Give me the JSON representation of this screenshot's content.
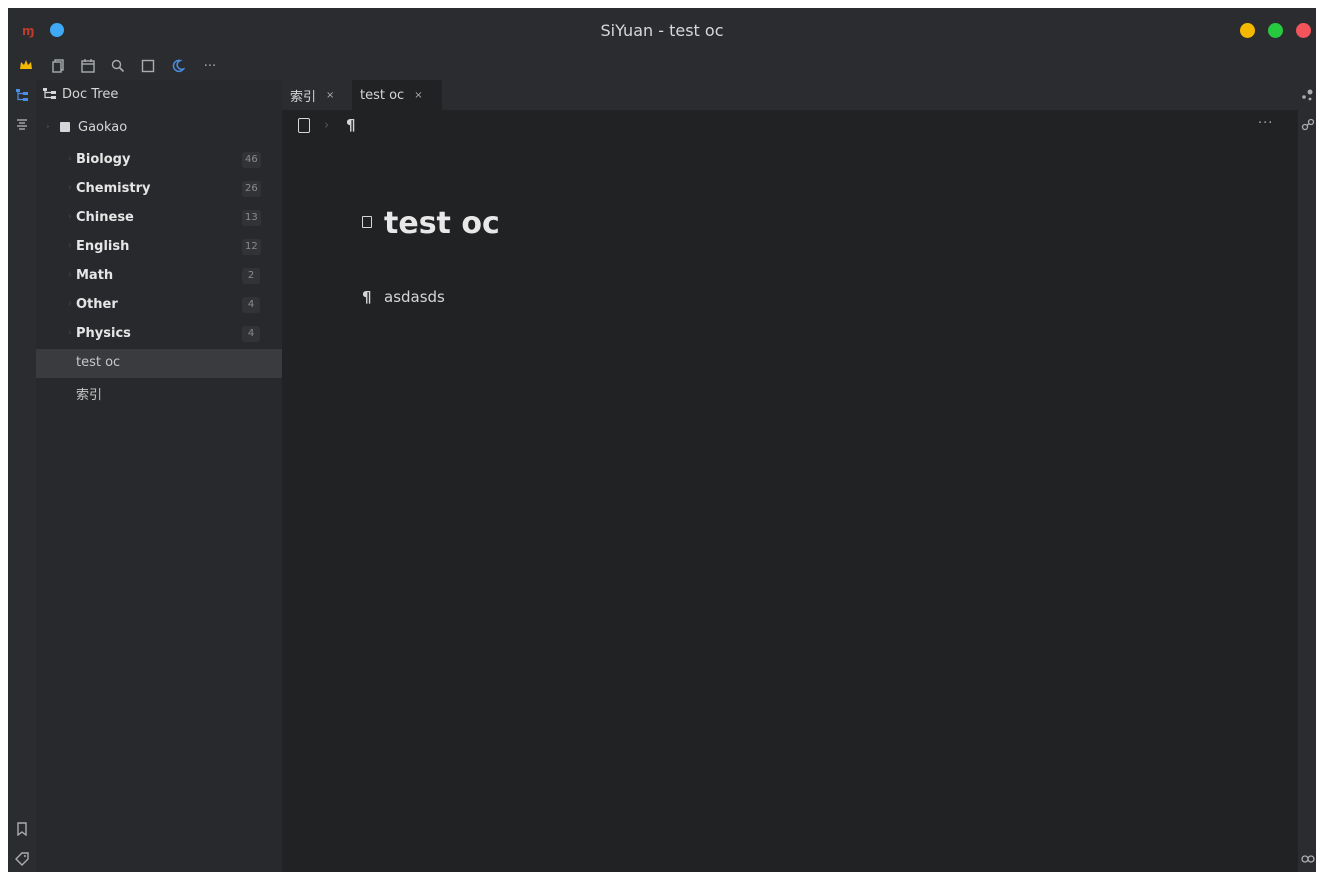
{
  "window": {
    "title": "SiYuan - test oc"
  },
  "toolbar": {
    "icons": [
      "crown-icon",
      "copy-icon",
      "calendar-icon",
      "search-icon",
      "square-icon",
      "moon-icon",
      "more-icon"
    ]
  },
  "tree": {
    "header_label": "Doc Tree",
    "notebook": "Gaokao",
    "docs": [
      {
        "label": "Biology",
        "count": "46",
        "bold": true
      },
      {
        "label": "Chemistry",
        "count": "26",
        "bold": true
      },
      {
        "label": "Chinese",
        "count": "13",
        "bold": true
      },
      {
        "label": "English",
        "count": "12",
        "bold": true
      },
      {
        "label": "Math",
        "count": "2",
        "bold": true
      },
      {
        "label": "Other",
        "count": "4",
        "bold": true
      },
      {
        "label": "Physics",
        "count": "4",
        "bold": true
      },
      {
        "label": "test oc",
        "count": "",
        "bold": false
      },
      {
        "label": "索引",
        "count": "",
        "bold": false
      }
    ]
  },
  "tabs": [
    {
      "label": "索引",
      "close": "×"
    },
    {
      "label": "test oc",
      "close": "×"
    }
  ],
  "breadcrumb": {
    "para_symbol": "¶",
    "more": "···"
  },
  "document": {
    "title": "test oc",
    "para_symbol": "¶",
    "paragraph": "asdasds"
  }
}
